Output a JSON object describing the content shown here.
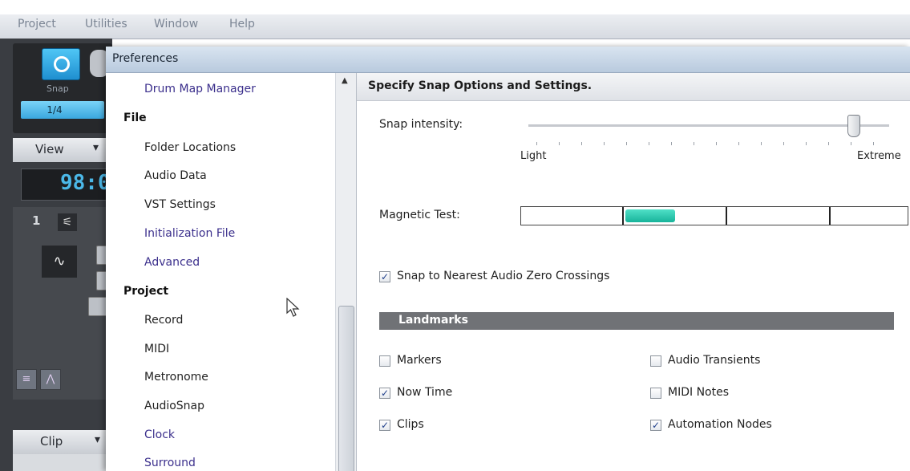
{
  "menubar": {
    "items": [
      "Project",
      "Utilities",
      "Window",
      "Help"
    ]
  },
  "app": {
    "snap_label": "Snap",
    "snap_value": "1/4",
    "view_label": "View",
    "view_dropdown": "▾",
    "time_display": "98:0",
    "track_number": "1",
    "clip_label": "Clip",
    "clip_dropdown": "▾"
  },
  "dialog": {
    "title": "Preferences",
    "nav": {
      "items": [
        {
          "label": "Drum Map Manager",
          "kind": "link"
        },
        {
          "label": "File",
          "kind": "category"
        },
        {
          "label": "Folder Locations",
          "kind": "item"
        },
        {
          "label": "Audio Data",
          "kind": "item"
        },
        {
          "label": "VST Settings",
          "kind": "item"
        },
        {
          "label": "Initialization File",
          "kind": "link"
        },
        {
          "label": "Advanced",
          "kind": "link"
        },
        {
          "label": "Project",
          "kind": "category"
        },
        {
          "label": "Record",
          "kind": "item"
        },
        {
          "label": "MIDI",
          "kind": "item"
        },
        {
          "label": "Metronome",
          "kind": "item"
        },
        {
          "label": "AudioSnap",
          "kind": "item"
        },
        {
          "label": "Clock",
          "kind": "link"
        },
        {
          "label": "Surround",
          "kind": "link"
        }
      ]
    },
    "content": {
      "section_title": "Specify Snap Options and Settings.",
      "snap_intensity_label": "Snap intensity:",
      "slider_min_label": "Light",
      "slider_max_label": "Extreme",
      "snap_intensity_value": 0.9,
      "magnetic_test_label": "Magnetic Test:",
      "zero_crossings": {
        "label": "Snap to Nearest Audio Zero Crossings",
        "checked": true
      },
      "landmarks_title": "Landmarks",
      "landmarks": [
        {
          "label": "Markers",
          "checked": false
        },
        {
          "label": "Now Time",
          "checked": true
        },
        {
          "label": "Clips",
          "checked": true
        },
        {
          "label": "Audio Transients",
          "checked": false
        },
        {
          "label": "MIDI Notes",
          "checked": false
        },
        {
          "label": "Automation Nodes",
          "checked": true
        }
      ]
    }
  },
  "colors": {
    "accent_teal": "#1fc2a6",
    "link_purple": "#3b2f8c",
    "snap_blue": "#3aa7de",
    "landmarks_bar": "#707276"
  }
}
